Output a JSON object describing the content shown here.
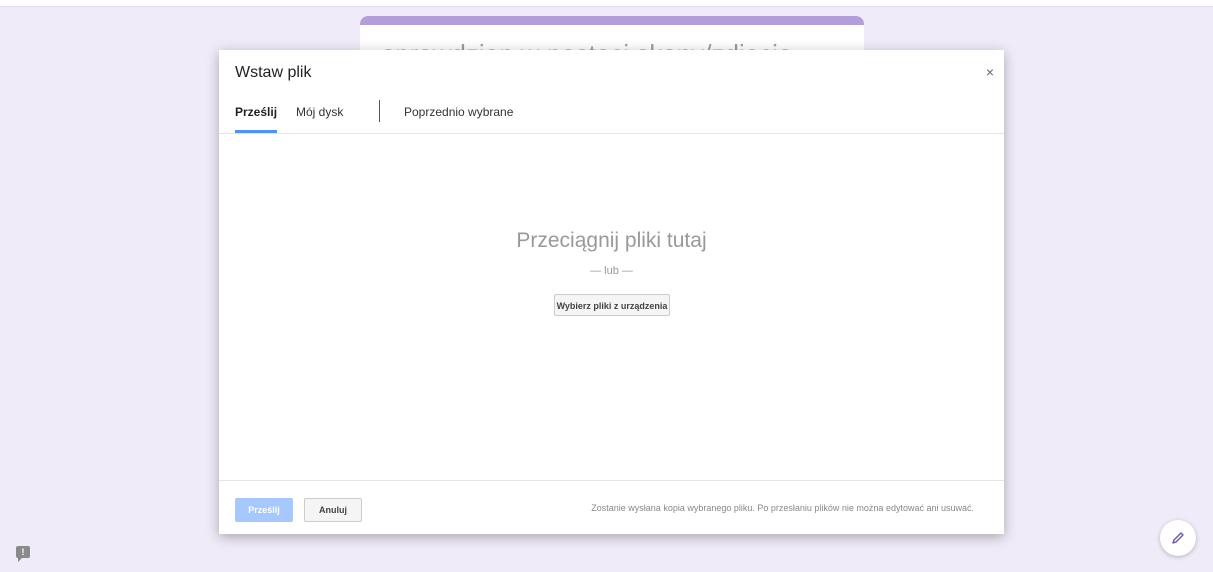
{
  "background": {
    "form_title": "sprawdzian w postaci skany/zdjęcia"
  },
  "dialog": {
    "title": "Wstaw plik",
    "close_label": "×",
    "tabs": [
      {
        "label": "Prześlij",
        "active": true
      },
      {
        "label": "Mój dysk",
        "active": false
      },
      {
        "label": "Poprzednio wybrane",
        "active": false
      }
    ],
    "drop": {
      "title": "Przeciągnij pliki tutaj",
      "or_text": "— lub —",
      "choose_button": "Wybierz pliki z urządzenia"
    },
    "footer": {
      "upload_button": "Prześlij",
      "cancel_button": "Anuluj",
      "note": "Zostanie wysłana kopia wybranego pliku. Po przesłaniu plików nie można edytować ani usuwać."
    }
  },
  "feedback": {
    "label": "!"
  },
  "colors": {
    "accent_tab": "#4d90fe",
    "form_accent": "#b39ddb",
    "page_background": "#f0ebf8",
    "upload_disabled": "#a6c8ff"
  },
  "icons": {
    "close": "close-icon",
    "feedback": "feedback-icon",
    "edit": "pencil-icon"
  }
}
